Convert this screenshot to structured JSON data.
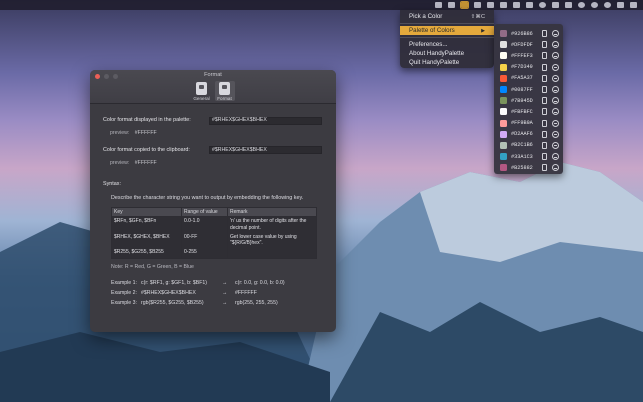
{
  "menubar": {
    "icons": [
      "notification-icon",
      "dropbox-icon",
      "handypalette-icon",
      "chat-icon",
      "cloud-icon",
      "grid-icon",
      "display-icon",
      "battery-icon",
      "wifi-icon",
      "bluetooth-icon",
      "volume-icon",
      "siri-icon",
      "search-icon",
      "user-icon",
      "list-icon",
      "menu-icon"
    ]
  },
  "menu": {
    "items": [
      {
        "label": "Pick a Color",
        "shortcut": "⇧⌘C"
      },
      {
        "label": "Palette of Colors",
        "arrow": "▶"
      },
      {
        "label": "Preferences..."
      },
      {
        "label": "About HandyPalette"
      },
      {
        "label": "Quit HandyPalette"
      }
    ]
  },
  "palette": {
    "colors": [
      {
        "hex": "#926B86",
        "color": "#926B86"
      },
      {
        "hex": "#DFDFDF",
        "color": "#DFDFDF"
      },
      {
        "hex": "#FFFEF3",
        "color": "#FFFEF3"
      },
      {
        "hex": "#F7D349",
        "color": "#F7D349"
      },
      {
        "hex": "#FA5A37",
        "color": "#FA5A37"
      },
      {
        "hex": "#0087FF",
        "color": "#0087FF"
      },
      {
        "hex": "#7B945D",
        "color": "#7B945D"
      },
      {
        "hex": "#FBFBFC",
        "color": "#FBFBFC"
      },
      {
        "hex": "#FF9B9A",
        "color": "#FF9B9A"
      },
      {
        "hex": "#D2AAF6",
        "color": "#D2AAF6"
      },
      {
        "hex": "#B2C1B6",
        "color": "#B2C1B6"
      },
      {
        "hex": "#33A1C3",
        "color": "#33A1C3"
      },
      {
        "hex": "#B25882",
        "color": "#B25882"
      }
    ]
  },
  "window": {
    "title": "Format",
    "tabs": [
      {
        "label": "General"
      },
      {
        "label": "Format"
      }
    ],
    "palette_format": {
      "label": "Color format displayed in the palette:",
      "value": "#$RHEX$GHEX$BHEX",
      "preview_label": "preview:",
      "preview_value": "#FFFFFF"
    },
    "clipboard_format": {
      "label": "Color format copied to the clipboard:",
      "value": "#$RHEX$GHEX$BHEX",
      "preview_label": "preview:",
      "preview_value": "#FFFFFF"
    },
    "syntax_label": "Syntax:",
    "syntax_desc": "Describe the character string you want to output by embedding the following key.",
    "table": {
      "headers": [
        "Key",
        "Range of value",
        "Remark"
      ],
      "rows": [
        [
          "$RFn, $GFn, $BFn",
          "0.0-1.0",
          "'n' us the number of digits after the decimal point."
        ],
        [
          "$RHEX, $GHEX, $BHEX",
          "00-FF",
          "Get lower case value by using \"${R/G/B}hex\"."
        ],
        [
          "$R255, $G255, $B255",
          "0-255",
          ""
        ]
      ]
    },
    "note": "Note: R = Red, G = Green, B = Blue",
    "examples": [
      {
        "label": "Example 1:",
        "input": "c(r: $RF1, g: $GF1, b: $BF1)",
        "arrow": "→",
        "output": "c(r: 0.0, g: 0.0, b: 0.0)"
      },
      {
        "label": "Example 2:",
        "input": "#$RHEX$GHEX$BHEX",
        "arrow": "→",
        "output": "#FFFFFF"
      },
      {
        "label": "Example 3:",
        "input": "rgb($R255, $G255, $B255)",
        "arrow": "→",
        "output": "rgb(255, 255, 255)"
      }
    ]
  }
}
